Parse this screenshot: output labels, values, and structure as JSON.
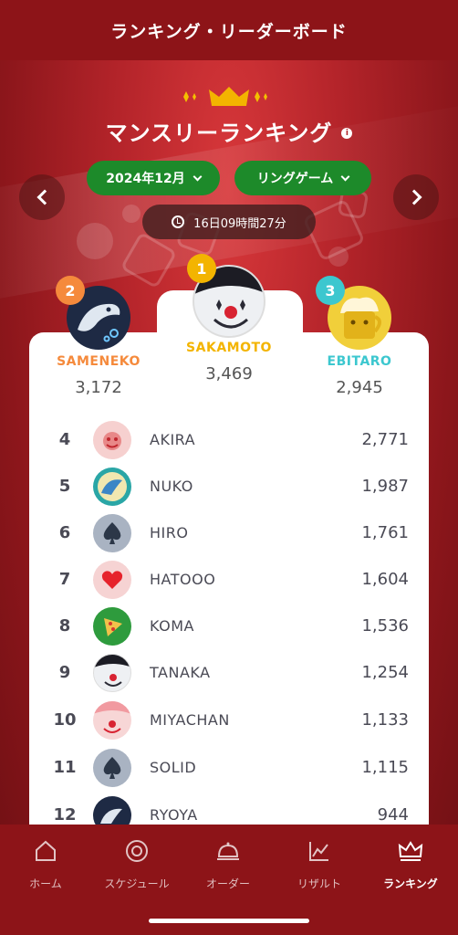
{
  "header": {
    "title": "ランキング・リーダーボード"
  },
  "hero": {
    "crown_icon": "crown-icon",
    "title": "マンスリーランキング",
    "info_icon": "info-icon",
    "month_select": "2024年12月",
    "game_select": "リングゲーム",
    "countdown": "16日09時間27分"
  },
  "podium": [
    {
      "rank": "1",
      "name": "SAKAMOTO",
      "score": "3,469",
      "color": "#f3b400"
    },
    {
      "rank": "2",
      "name": "SAMENEKO",
      "score": "3,172",
      "color": "#f58a3c"
    },
    {
      "rank": "3",
      "name": "EBITARO",
      "score": "2,945",
      "color": "#3cc7cf"
    }
  ],
  "rows": [
    {
      "rank": "4",
      "name": "AKIRA",
      "score": "2,771",
      "avatar": "pink-face"
    },
    {
      "rank": "5",
      "name": "NUKO",
      "score": "1,987",
      "avatar": "teal-shark"
    },
    {
      "rank": "6",
      "name": "HIRO",
      "score": "1,761",
      "avatar": "spade"
    },
    {
      "rank": "7",
      "name": "HATOOO",
      "score": "1,604",
      "avatar": "heart"
    },
    {
      "rank": "8",
      "name": "KOMA",
      "score": "1,536",
      "avatar": "pizza"
    },
    {
      "rank": "9",
      "name": "TANAKA",
      "score": "1,254",
      "avatar": "clown"
    },
    {
      "rank": "10",
      "name": "MIYACHAN",
      "score": "1,133",
      "avatar": "pink-clown"
    },
    {
      "rank": "11",
      "name": "SOLID",
      "score": "1,115",
      "avatar": "spade"
    },
    {
      "rank": "12",
      "name": "RYOYA",
      "score": "944",
      "avatar": "shark"
    }
  ],
  "nav": [
    {
      "label": "ホーム",
      "icon": "home-icon"
    },
    {
      "label": "スケジュール",
      "icon": "lifebuoy-icon"
    },
    {
      "label": "オーダー",
      "icon": "cloche-icon"
    },
    {
      "label": "リザルト",
      "icon": "chart-icon"
    },
    {
      "label": "ランキング",
      "icon": "crown-icon",
      "active": true
    }
  ],
  "colors": {
    "primary": "#8d1418",
    "accent_green": "#1d8a2a",
    "gold": "#f3b400"
  }
}
